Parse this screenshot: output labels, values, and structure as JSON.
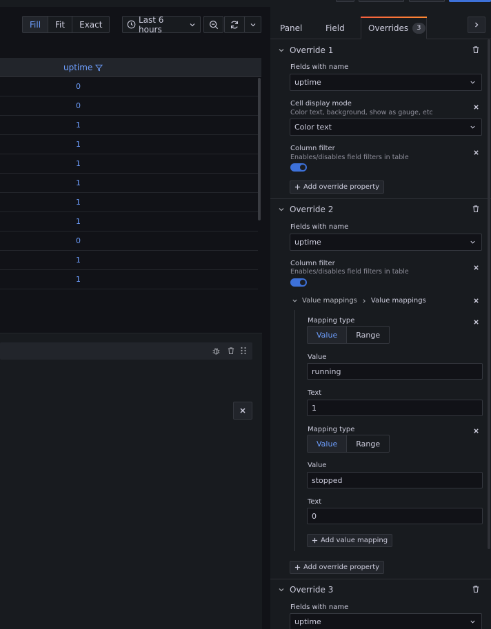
{
  "toolbar": {
    "view_modes": [
      "Fill",
      "Fit",
      "Exact"
    ],
    "active_view_mode": "Fill",
    "time_range": "Last 6 hours"
  },
  "table": {
    "column": "uptime",
    "rows": [
      "0",
      "0",
      "1",
      "1",
      "1",
      "1",
      "1",
      "1",
      "0",
      "1",
      "1"
    ]
  },
  "tabs": {
    "panel": "Panel",
    "field": "Field",
    "overrides": "Overrides",
    "overrides_count": "3"
  },
  "overrides": {
    "o1": {
      "title": "Override 1",
      "matcher_label": "Fields with name",
      "matcher_value": "uptime",
      "cell_mode_label": "Cell display mode",
      "cell_mode_desc": "Color text, background, show as gauge, etc",
      "cell_mode_value": "Color text",
      "filter_label": "Column filter",
      "filter_desc": "Enables/disables field filters in table",
      "add_property": "Add override property"
    },
    "o2": {
      "title": "Override 2",
      "matcher_label": "Fields with name",
      "matcher_value": "uptime",
      "filter_label": "Column filter",
      "filter_desc": "Enables/disables field filters in table",
      "vm_parent": "Value mappings",
      "vm_child": "Value mappings",
      "mappings": [
        {
          "type_label": "Mapping type",
          "type_options": [
            "Value",
            "Range"
          ],
          "active": "Value",
          "value_label": "Value",
          "value": "running",
          "text_label": "Text",
          "text": "1"
        },
        {
          "type_label": "Mapping type",
          "type_options": [
            "Value",
            "Range"
          ],
          "active": "Value",
          "value_label": "Value",
          "value": "stopped",
          "text_label": "Text",
          "text": "0"
        }
      ],
      "add_mapping": "Add value mapping",
      "add_property": "Add override property"
    },
    "o3": {
      "title": "Override 3",
      "matcher_label": "Fields with name",
      "matcher_value": "uptime"
    }
  },
  "colors": {
    "accent": "#6e9fff",
    "toggle_on": "#3d71d9",
    "tab_highlight": "#f55f3e"
  }
}
